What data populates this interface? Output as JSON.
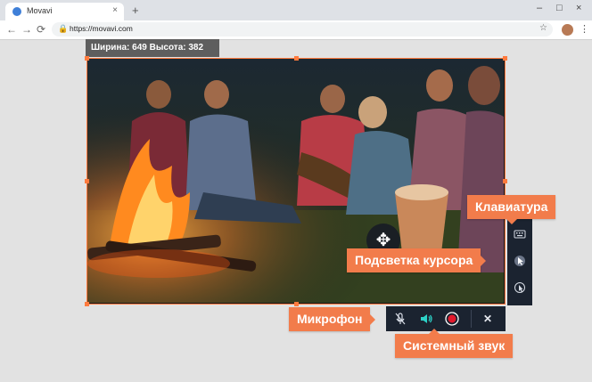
{
  "browser": {
    "tab_title": "Movavi",
    "tab_close": "×",
    "new_tab": "+",
    "url": "https://movavi.com",
    "window_min": "–",
    "window_max": "□",
    "window_close": "×",
    "back": "←",
    "forward": "→",
    "reload": "⟳",
    "star": "☆",
    "menu": "⋮"
  },
  "capture": {
    "size_label": "Ширина: 649  Высота: 382",
    "move_glyph": "✥"
  },
  "side_panel": {
    "icons": [
      "keyboard-icon",
      "cursor-highlight-icon",
      "click-icon"
    ]
  },
  "bottom_bar": {
    "mic_glyph": "🎤",
    "speaker_glyph": "🔊",
    "record_glyph": "●",
    "close_glyph": "✕"
  },
  "callouts": {
    "keyboard": "Клавиатура",
    "cursor_highlight": "Подсветка курсора",
    "microphone": "Микрофон",
    "system_sound": "Системный звук"
  },
  "colors": {
    "accent": "#ff7a3d",
    "callout": "#f27c4b",
    "panel": "#1b2330",
    "speaker_active": "#2dd2c8",
    "record": "#e2192c"
  }
}
